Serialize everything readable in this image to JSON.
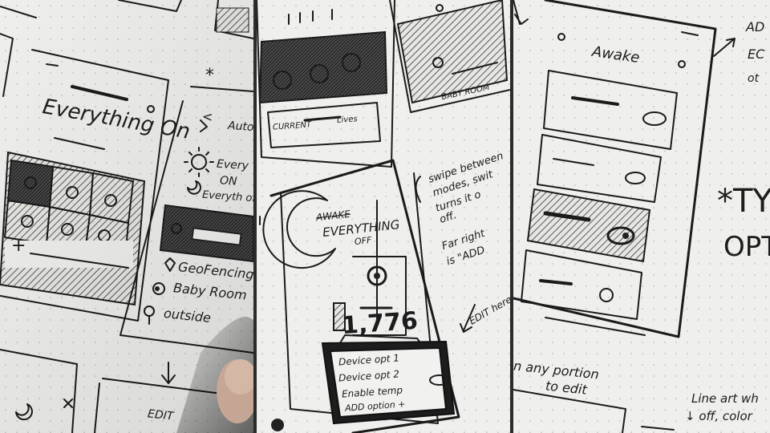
{
  "panel_left": {
    "phone_title": "Everything On",
    "mode_items": [
      {
        "icon": "sun-icon",
        "label": "Every"
      },
      {
        "icon": "sun-icon",
        "label": "ON"
      },
      {
        "icon": "moon-icon",
        "label": "Everyth of"
      }
    ],
    "location_items": [
      {
        "icon": "location-pin-icon",
        "label": "GeoFencing"
      },
      {
        "icon": "toggle-icon",
        "label": "Baby Room"
      },
      {
        "icon": "tree-icon",
        "label": "outside"
      }
    ],
    "partial_header": "Auto",
    "bottom_label": "EDIT",
    "plus": "+",
    "back_arrow": "<",
    "asterisk": "*",
    "down_arrow": "↓"
  },
  "panel_middle": {
    "top_card_label": "CURRENT",
    "top_card_label2": "Lives",
    "right_sketch_label": "BABY ROOM",
    "phone_title_line1": "EVERYTHING",
    "phone_title_line2": "OFF",
    "strikeout_text": "AWAKE",
    "big_number": "1,776",
    "options": [
      "Device opt 1",
      "Device opt 2",
      "Enable temp",
      "ADD option +"
    ],
    "note_lines": [
      "swipe between",
      "modes, swit",
      "turns it o",
      "off.",
      "Far right",
      "is \"ADD"
    ],
    "edit_note": "EDIT here",
    "plus": "+"
  },
  "panel_right": {
    "phone_title": "Awake",
    "note_top_lines": [
      "AD",
      "EC",
      "ot"
    ],
    "note_side_lines": [
      "*TYP",
      "OPTI"
    ],
    "note_bottom_left_lines": [
      "n any portion",
      "to edit"
    ],
    "note_bottom_right_lines": [
      "Line art wh",
      "↓ off, color"
    ]
  }
}
